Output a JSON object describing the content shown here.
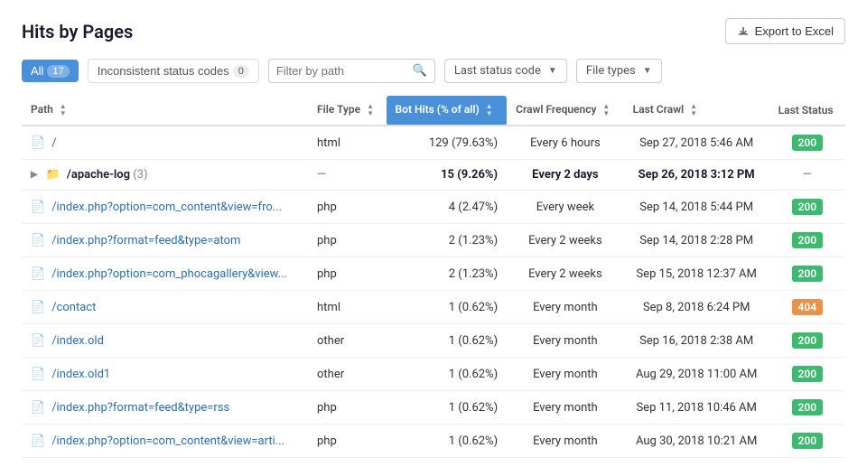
{
  "title": "Hits by Pages",
  "export_btn": "Export to Excel",
  "tabs": [
    {
      "id": "all",
      "label": "All",
      "count": "17",
      "active": true
    },
    {
      "id": "inconsistent",
      "label": "Inconsistent status codes",
      "count": "0",
      "active": false
    }
  ],
  "search": {
    "placeholder": "Filter by path"
  },
  "dropdowns": [
    {
      "id": "last-status",
      "label": "Last status code"
    },
    {
      "id": "file-types",
      "label": "File types"
    }
  ],
  "columns": [
    {
      "id": "path",
      "label": "Path",
      "active": false
    },
    {
      "id": "file-type",
      "label": "File Type",
      "active": false
    },
    {
      "id": "bot-hits",
      "label": "Bot Hits (% of all)",
      "active": true
    },
    {
      "id": "crawl-freq",
      "label": "Crawl Frequency",
      "active": false
    },
    {
      "id": "last-crawl",
      "label": "Last Crawl",
      "active": false
    },
    {
      "id": "last-status",
      "label": "Last Status",
      "active": false
    }
  ],
  "rows": [
    {
      "path": "/",
      "type": "file",
      "file_type": "html",
      "bot_hits": "129 (79.63%)",
      "crawl_freq": "Every 6 hours",
      "last_crawl": "Sep 27, 2018 5:46 AM",
      "last_status": "200",
      "status_class": "badge-200",
      "bold": false,
      "folder": false,
      "dash_status": false
    },
    {
      "path": "/apache-log",
      "count_label": "(3)",
      "type": "folder",
      "file_type": "—",
      "bot_hits": "15 (9.26%)",
      "crawl_freq": "Every 2 days",
      "last_crawl": "Sep 26, 2018 3:12 PM",
      "last_status": "—",
      "status_class": "",
      "bold": true,
      "folder": true,
      "dash_status": true
    },
    {
      "path": "/index.php?option=com_content&view=fro...",
      "type": "file",
      "file_type": "php",
      "bot_hits": "4 (2.47%)",
      "crawl_freq": "Every week",
      "last_crawl": "Sep 14, 2018 5:44 PM",
      "last_status": "200",
      "status_class": "badge-200",
      "bold": false,
      "folder": false,
      "dash_status": false
    },
    {
      "path": "/index.php?format=feed&type=atom",
      "type": "file",
      "file_type": "php",
      "bot_hits": "2 (1.23%)",
      "crawl_freq": "Every 2 weeks",
      "last_crawl": "Sep 14, 2018 2:28 PM",
      "last_status": "200",
      "status_class": "badge-200",
      "bold": false,
      "folder": false,
      "dash_status": false
    },
    {
      "path": "/index.php?option=com_phocagallery&view...",
      "type": "file",
      "file_type": "php",
      "bot_hits": "2 (1.23%)",
      "crawl_freq": "Every 2 weeks",
      "last_crawl": "Sep 15, 2018 12:37 AM",
      "last_status": "200",
      "status_class": "badge-200",
      "bold": false,
      "folder": false,
      "dash_status": false
    },
    {
      "path": "/contact",
      "type": "file",
      "file_type": "html",
      "bot_hits": "1 (0.62%)",
      "crawl_freq": "Every month",
      "last_crawl": "Sep 8, 2018 6:24 PM",
      "last_status": "404",
      "status_class": "badge-404",
      "bold": false,
      "folder": false,
      "dash_status": false
    },
    {
      "path": "/index.old",
      "type": "file",
      "file_type": "other",
      "bot_hits": "1 (0.62%)",
      "crawl_freq": "Every month",
      "last_crawl": "Sep 16, 2018 2:38 AM",
      "last_status": "200",
      "status_class": "badge-200",
      "bold": false,
      "folder": false,
      "dash_status": false
    },
    {
      "path": "/index.old1",
      "type": "file",
      "file_type": "other",
      "bot_hits": "1 (0.62%)",
      "crawl_freq": "Every month",
      "last_crawl": "Aug 29, 2018 11:00 AM",
      "last_status": "200",
      "status_class": "badge-200",
      "bold": false,
      "folder": false,
      "dash_status": false
    },
    {
      "path": "/index.php?format=feed&type=rss",
      "type": "file",
      "file_type": "php",
      "bot_hits": "1 (0.62%)",
      "crawl_freq": "Every month",
      "last_crawl": "Sep 11, 2018 10:46 AM",
      "last_status": "200",
      "status_class": "badge-200",
      "bold": false,
      "folder": false,
      "dash_status": false
    },
    {
      "path": "/index.php?option=com_content&view=arti...",
      "type": "file",
      "file_type": "php",
      "bot_hits": "1 (0.62%)",
      "crawl_freq": "Every month",
      "last_crawl": "Aug 30, 2018 10:21 AM",
      "last_status": "200",
      "status_class": "badge-200",
      "bold": false,
      "folder": false,
      "dash_status": false
    }
  ]
}
